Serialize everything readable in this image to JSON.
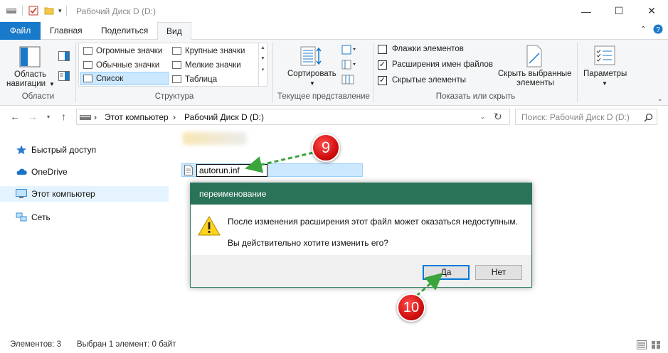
{
  "window": {
    "title": "Рабочий Диск D (D:)"
  },
  "ribbon_tabs": [
    "Файл",
    "Главная",
    "Поделиться",
    "Вид"
  ],
  "ribbon": {
    "areas": {
      "nav_pane_label_1": "Область",
      "nav_pane_label_2": "навигации",
      "group_label": "Области"
    },
    "layout": {
      "items": [
        "Огромные значки",
        "Крупные значки",
        "Обычные значки",
        "Мелкие значки",
        "Список",
        "Таблица"
      ],
      "selected": "Список",
      "group_label": "Структура"
    },
    "current_view": {
      "sort_label": "Сортировать",
      "group_label": "Текущее представление"
    },
    "show_hide": {
      "checkboxes": [
        {
          "label": "Флажки элементов",
          "checked": false
        },
        {
          "label": "Расширения имен файлов",
          "checked": true
        },
        {
          "label": "Скрытые элементы",
          "checked": true
        }
      ],
      "hide_selected_1": "Скрыть выбранные",
      "hide_selected_2": "элементы",
      "group_label": "Показать или скрыть"
    },
    "options_label": "Параметры"
  },
  "address": {
    "crumbs": [
      "Этот компьютер",
      "Рабочий Диск D (D:)"
    ],
    "search_placeholder": "Поиск: Рабочий Диск D (D:)"
  },
  "nav_pane": {
    "items": [
      {
        "label": "Быстрый доступ",
        "icon": "star-icon"
      },
      {
        "label": "OneDrive",
        "icon": "cloud-icon"
      },
      {
        "label": "Этот компьютер",
        "icon": "computer-icon"
      },
      {
        "label": "Сеть",
        "icon": "network-icon"
      }
    ],
    "selected": "Этот компьютер"
  },
  "content": {
    "rename_value": "autorun.inf"
  },
  "dialog": {
    "title": "переименование",
    "message": "После изменения расширения этот файл может оказаться недоступным.",
    "question": "Вы действительно хотите изменить его?",
    "yes": "Да",
    "no": "Нет"
  },
  "status": {
    "items_count": "Элементов: 3",
    "selected_info": "Выбран 1 элемент: 0 байт"
  },
  "annotations": {
    "marker_9": "9",
    "marker_10": "10"
  },
  "colors": {
    "accent": "#1979ca",
    "dialog_title": "#2a7258",
    "selection": "#cce8ff",
    "marker": "#d10f0f",
    "arrow": "#3aa53a"
  }
}
